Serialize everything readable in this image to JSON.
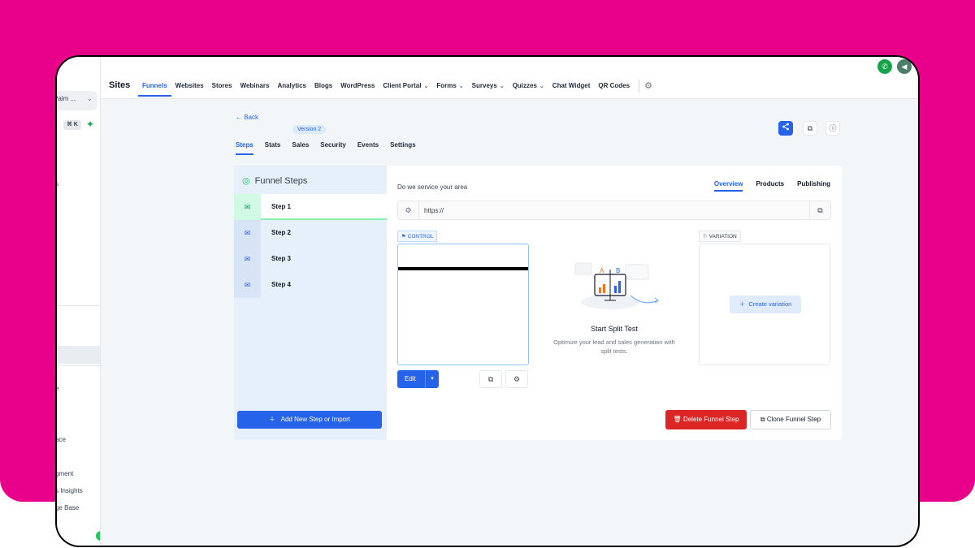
{
  "sidebar": {
    "workspace": "Palm ...",
    "shortcut": "⌘ K",
    "items": [
      "s",
      "e",
      "ace",
      "gment",
      "s Insights",
      "ge Base"
    ]
  },
  "topbar": {
    "title": "Sites",
    "nav": [
      {
        "label": "Funnels",
        "active": true,
        "dropdown": false
      },
      {
        "label": "Websites",
        "dropdown": false
      },
      {
        "label": "Stores",
        "dropdown": false
      },
      {
        "label": "Webinars",
        "dropdown": false
      },
      {
        "label": "Analytics",
        "dropdown": false
      },
      {
        "label": "Blogs",
        "dropdown": false
      },
      {
        "label": "WordPress",
        "dropdown": false
      },
      {
        "label": "Client Portal",
        "dropdown": true
      },
      {
        "label": "Forms",
        "dropdown": true
      },
      {
        "label": "Surveys",
        "dropdown": true
      },
      {
        "label": "Quizzes",
        "dropdown": true
      },
      {
        "label": "Chat Widget",
        "dropdown": false
      },
      {
        "label": "QR Codes",
        "dropdown": false
      }
    ]
  },
  "header": {
    "back": "Back",
    "version": "Version 2",
    "tabs": [
      "Steps",
      "Stats",
      "Sales",
      "Security",
      "Events",
      "Settings"
    ],
    "active_tab": "Steps"
  },
  "steps_panel": {
    "title": "Funnel Steps",
    "steps": [
      "Step 1",
      "Step 2",
      "Step 3",
      "Step 4"
    ],
    "active_step": "Step 1",
    "add_button": "Add New Step or Import"
  },
  "detail": {
    "title": "Do we service your area",
    "tabs": [
      "Overview",
      "Products",
      "Publishing"
    ],
    "active_tab": "Overview",
    "url": "https://",
    "control_label": "CONTROL",
    "variation_label": "VARIATION",
    "edit_label": "Edit",
    "split_title": "Start Split Test",
    "split_desc": "Optimize your lead and sales generation with split tests.",
    "create_variation": "Create variation",
    "delete_step": "Delete Funnel Step",
    "clone_step": "Clone Funnel Step"
  },
  "colors": {
    "brand_pink": "#e8008a",
    "primary": "#2563eb",
    "danger": "#dc2626",
    "success": "#22c55e"
  }
}
